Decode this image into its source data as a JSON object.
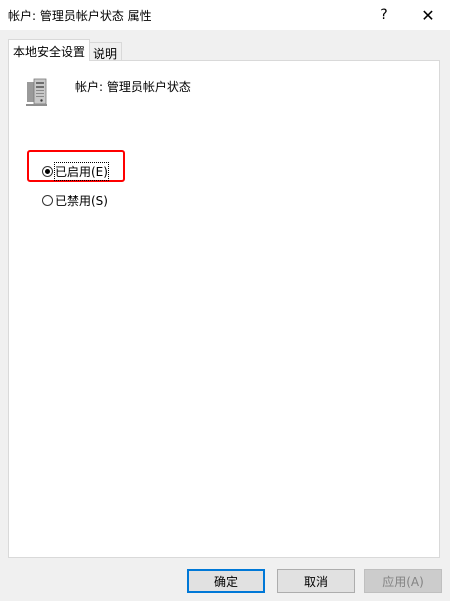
{
  "window": {
    "title": "帐户: 管理员帐户状态 属性",
    "help_glyph": "?",
    "close_glyph": "✕"
  },
  "tabs": [
    {
      "label": "本地安全设置",
      "active": true
    },
    {
      "label": "说明",
      "active": false
    }
  ],
  "policy": {
    "name": "帐户: 管理员帐户状态",
    "icon": "server-icon"
  },
  "options": [
    {
      "label": "已启用(E)",
      "checked": true
    },
    {
      "label": "已禁用(S)",
      "checked": false
    }
  ],
  "buttons": {
    "ok": "确定",
    "cancel": "取消",
    "apply": "应用(A)"
  },
  "colors": {
    "highlight": "#ff0000",
    "default_button_border": "#0078d7"
  }
}
